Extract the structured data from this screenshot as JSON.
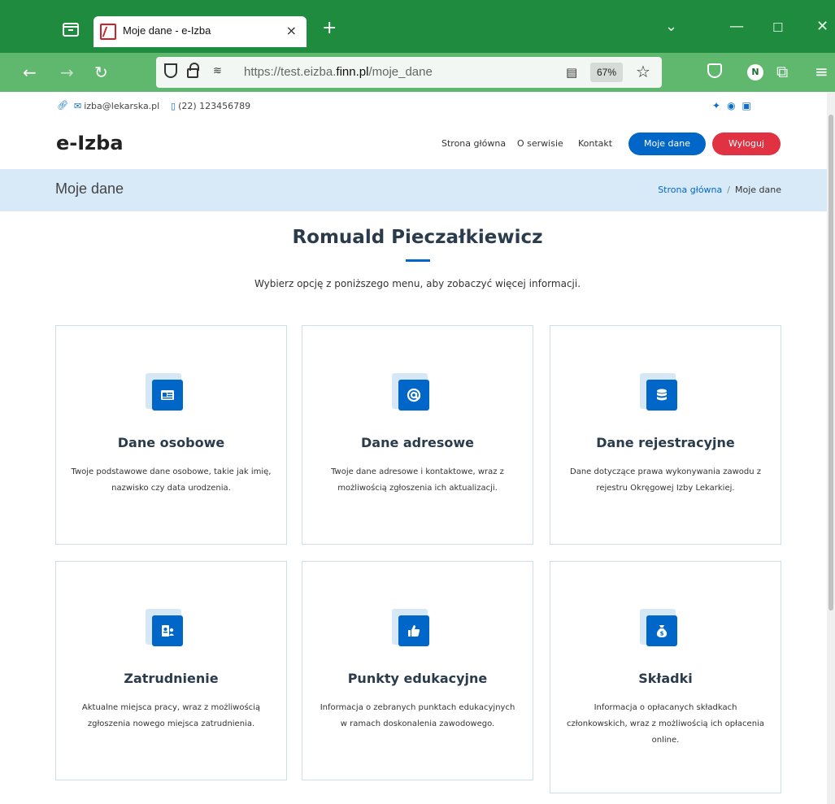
{
  "browser": {
    "tab_title": "Moje dane - e-Izba",
    "tab_close": "×",
    "new_tab": "+",
    "url_prefix": "https://test.eizba.",
    "url_domain": "finn.pl",
    "url_path": "/moje_dane",
    "zoom": "67%",
    "profile_initial": "N"
  },
  "topbar": {
    "email": "izba@lekarska.pl",
    "phone": "(22) 123456789"
  },
  "header": {
    "logo": "e-Izba",
    "menu": [
      "Strona główna",
      "O serwisie",
      "Kontakt"
    ],
    "btn_moje": "Moje dane",
    "btn_wyloguj": "Wyloguj"
  },
  "breadcrumb": {
    "title": "Moje dane",
    "home": "Strona główna",
    "separator": "/",
    "current": "Moje dane"
  },
  "main": {
    "user_name": "Romuald Pieczałkiewicz",
    "subtitle": "Wybierz opcję z poniższego menu, aby zobaczyć więcej informacji."
  },
  "cards": [
    {
      "title": "Dane osobowe",
      "icon": "id-card-icon",
      "desc": "Twoje podstawowe dane osobowe, takie jak imię, nazwisko czy data urodzenia."
    },
    {
      "title": "Dane adresowe",
      "icon": "at-sign-icon",
      "desc": "Twoje dane adresowe i kontaktowe, wraz z możliwością zgłoszenia ich aktualizacji."
    },
    {
      "title": "Dane rejestracyjne",
      "icon": "database-icon",
      "desc": "Dane dotyczące prawa wykonywania zawodu z rejestru Okręgowej Izby Lekarkiej."
    },
    {
      "title": "Zatrudnienie",
      "icon": "employee-badge-icon",
      "desc": "Aktualne miejsca pracy, wraz z możliwością zgłoszenia nowego miejsca zatrudnienia."
    },
    {
      "title": "Punkty edukacyjne",
      "icon": "thumbs-up-icon",
      "desc": "Informacja o zebranych punktach edukacyjnych w ramach doskonalenia zawodowego."
    },
    {
      "title": "Składki",
      "icon": "money-bag-icon",
      "desc": "Informacja o opłacanych składkach członkowskich, wraz z możliwością ich opłacenia online."
    }
  ],
  "colors": {
    "browser_tabbar": "#1e8b3e",
    "browser_navbar": "#5fb86e",
    "primary": "#0067c9",
    "danger": "#e03242",
    "breadcrumb_bg": "#d8eaf8"
  }
}
